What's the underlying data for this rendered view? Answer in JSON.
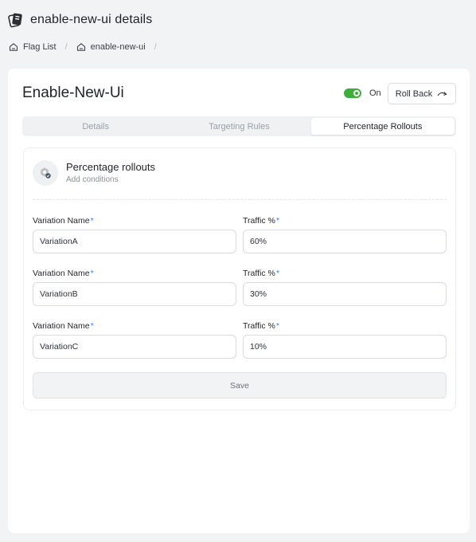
{
  "header": {
    "title": "enable-new-ui details"
  },
  "breadcrumb": {
    "items": [
      "Flag List",
      "enable-new-ui"
    ]
  },
  "flag": {
    "name": "Enable-New-Ui",
    "toggle_on": true,
    "toggle_label": "On",
    "rollback_label": "Roll Back"
  },
  "tabs": [
    {
      "label": "Details",
      "active": false
    },
    {
      "label": "Targeting Rules",
      "active": false
    },
    {
      "label": "Percentage Rollouts",
      "active": true
    }
  ],
  "rollouts": {
    "title": "Percentage rollouts",
    "subtitle": "Add conditions",
    "name_label": "Variation Name",
    "traffic_label": "Traffic %",
    "required_mark": "*",
    "rows": [
      {
        "name": "VariationA",
        "traffic": "60%"
      },
      {
        "name": "VariationB",
        "traffic": "30%"
      },
      {
        "name": "VariationC",
        "traffic": "10%"
      }
    ],
    "save_label": "Save"
  },
  "colors": {
    "toggle": "#3dae3b",
    "required": "#3b82f6"
  }
}
